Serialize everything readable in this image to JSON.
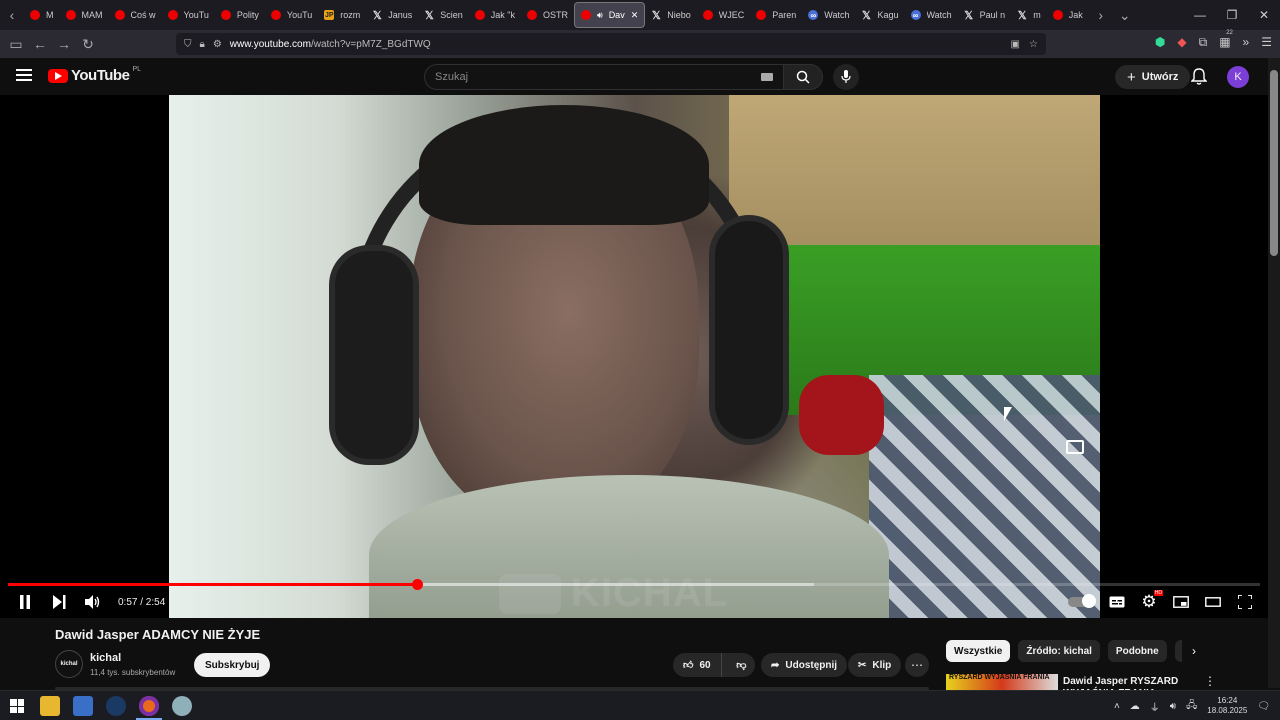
{
  "browser": {
    "tabs": [
      {
        "label": "M",
        "icon": "youtube-favicon"
      },
      {
        "label": "MAM",
        "icon": "youtube-favicon"
      },
      {
        "label": "Coś w",
        "icon": "youtube-favicon"
      },
      {
        "label": "YouTu",
        "icon": "youtube-favicon"
      },
      {
        "label": "Polity",
        "icon": "youtube-favicon"
      },
      {
        "label": "YouTu",
        "icon": "youtube-favicon"
      },
      {
        "label": "rozm",
        "icon": "jp-favicon"
      },
      {
        "label": "Janus",
        "icon": "x-favicon"
      },
      {
        "label": "Scien",
        "icon": "x-favicon"
      },
      {
        "label": "Jak \"k",
        "icon": "youtube-favicon"
      },
      {
        "label": "OSTR",
        "icon": "youtube-favicon"
      },
      {
        "label": "Dav",
        "icon": "youtube-favicon",
        "active": true
      },
      {
        "label": "Niebo",
        "icon": "x-favicon"
      },
      {
        "label": "WJEC",
        "icon": "youtube-favicon"
      },
      {
        "label": "Paren",
        "icon": "youtube-favicon"
      },
      {
        "label": "Watch",
        "icon": "blue-favicon"
      },
      {
        "label": "Kagu",
        "icon": "x-favicon"
      },
      {
        "label": "Watch",
        "icon": "blue-favicon"
      },
      {
        "label": "Paul n",
        "icon": "x-favicon"
      },
      {
        "label": "m",
        "icon": "x-favicon"
      },
      {
        "label": "Jak",
        "icon": "youtube-favicon"
      }
    ],
    "url_host": "www.youtube.com",
    "url_path": "/watch?v=pM7Z_BGdTWQ",
    "extension_badge": "22"
  },
  "header": {
    "logo_text": "YouTube",
    "region": "PL",
    "search_placeholder": "Szukaj",
    "create_label": "Utwórz",
    "avatar_letter": "K"
  },
  "player": {
    "current_time": "0:57",
    "duration": "2:54",
    "time_readout": "0:57 / 2:54",
    "progress_fraction": 0.327,
    "buffered_fraction": 0.644,
    "watermark_text": "KICHAL",
    "quality_badge": "HD"
  },
  "video": {
    "title": "Dawid Jasper ADAMCY NIE ŻYJE",
    "channel_name": "kichal",
    "channel_avatar_text": "kichal",
    "subscribers": "11,4 tys. subskrybentów",
    "subscribe_label": "Subskrybuj",
    "like_count": "60",
    "share_label": "Udostępnij",
    "clip_label": "Klip"
  },
  "sidebar": {
    "chips": [
      "Wszystkie",
      "Źródło: kichal",
      "Podobne",
      "Dla C"
    ],
    "recommendation": {
      "title": "Dawid Jasper RYSZARD WYJAŚNIA FRANIA",
      "thumb_text": "RYSZARD WYJAŚNIA FRANIA"
    }
  },
  "taskbar": {
    "time": "16:24",
    "date": "18.08.2025"
  }
}
